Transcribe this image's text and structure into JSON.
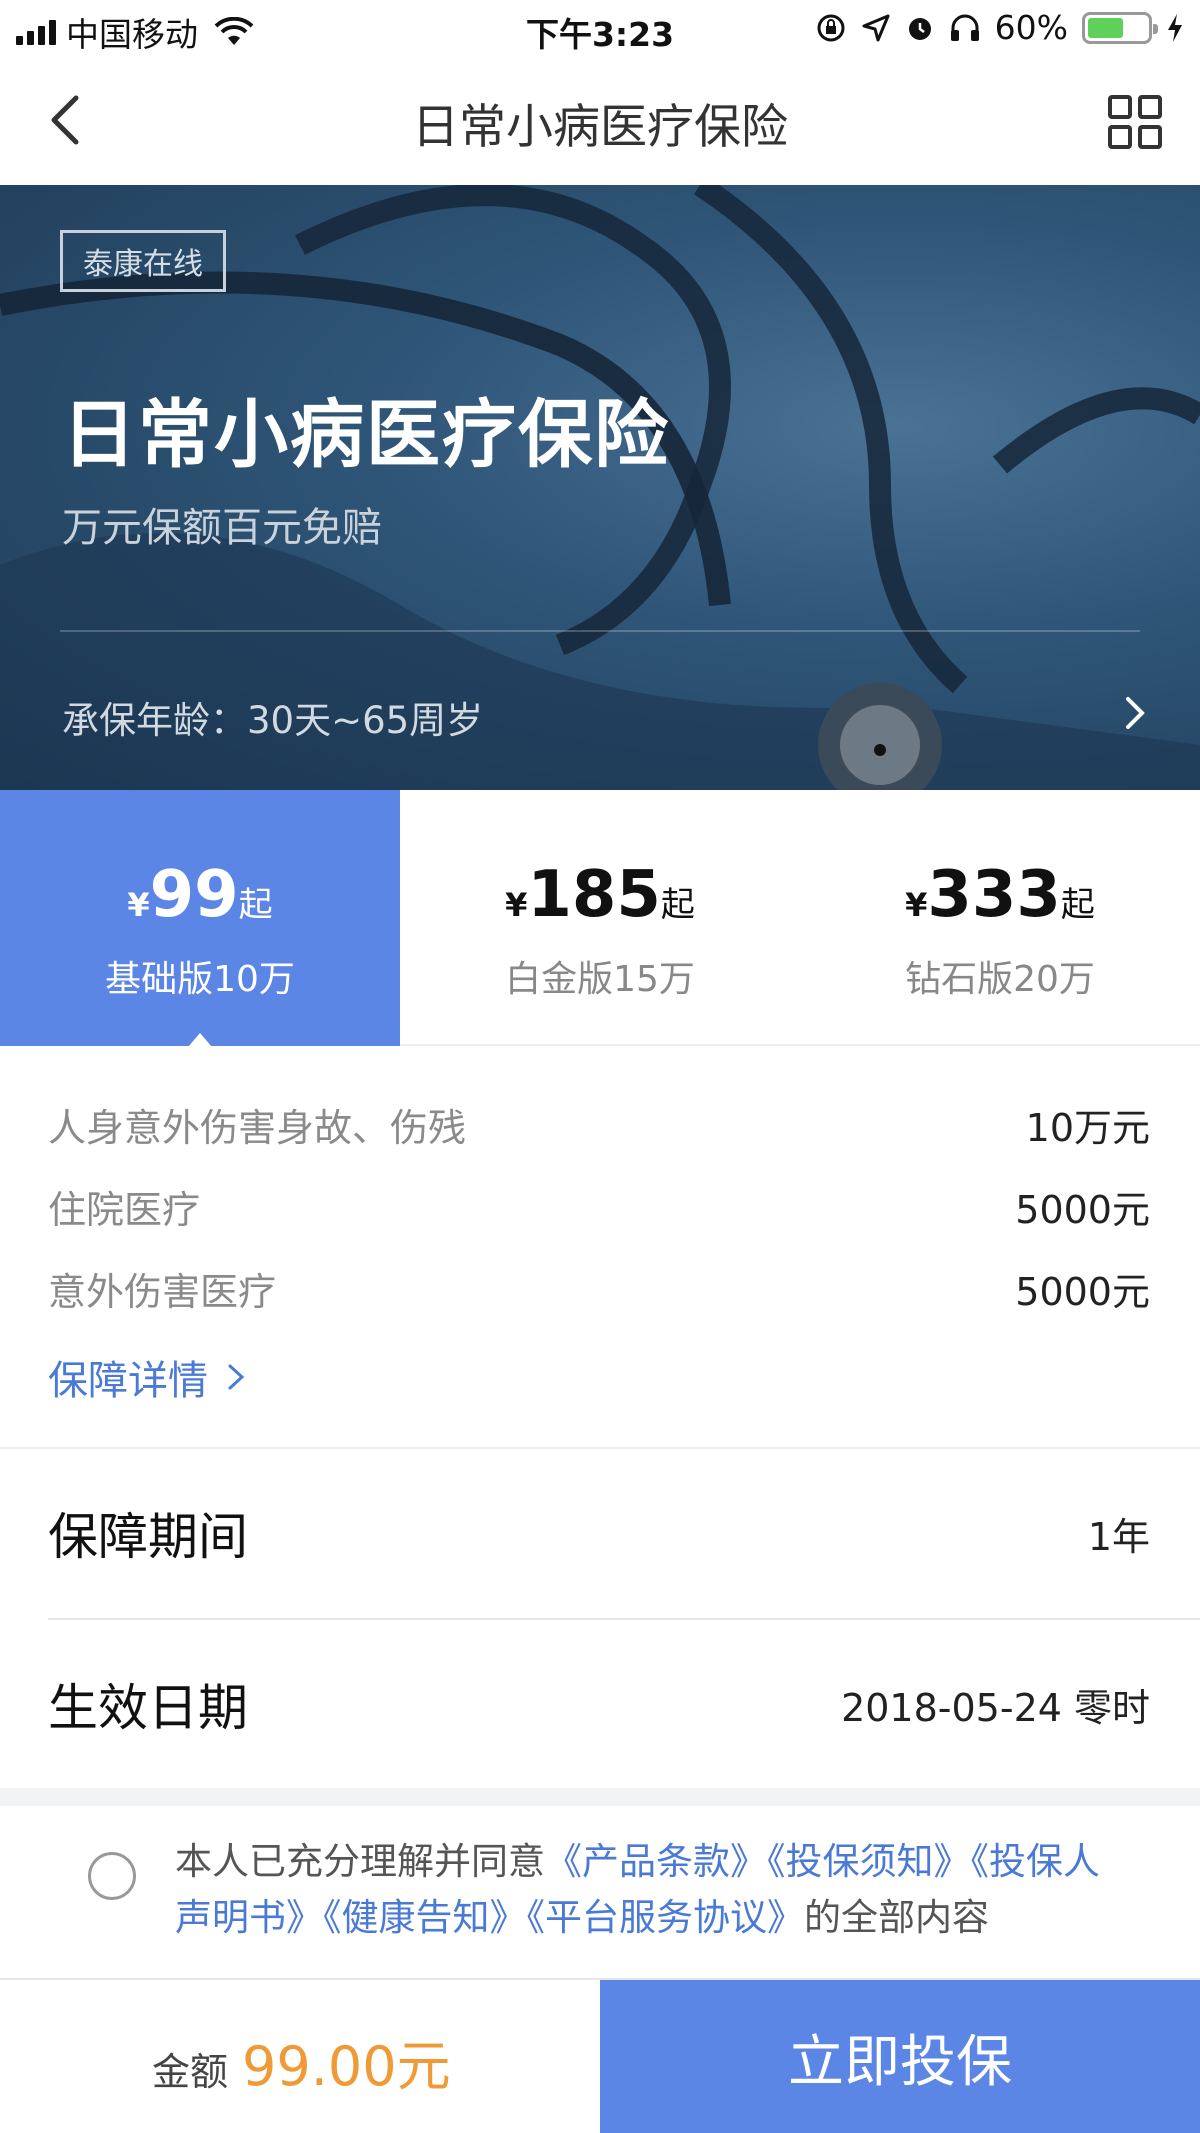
{
  "status_bar": {
    "carrier": "中国移动",
    "time": "下午3:23",
    "battery": "60%",
    "battery_level": 0.6
  },
  "nav": {
    "title": "日常小病医疗保险",
    "back_icon": "chevron-left-icon",
    "menu_icon": "grid-icon"
  },
  "hero": {
    "badge": "泰康在线",
    "title": "日常小病医疗保险",
    "subtitle": "万元保额百元免赔",
    "age_range": "承保年龄：30天~65周岁"
  },
  "plans": [
    {
      "symbol": "¥",
      "price": "99",
      "suffix": "起",
      "name": "基础版10万",
      "active": true
    },
    {
      "symbol": "¥",
      "price": "185",
      "suffix": "起",
      "name": "白金版15万",
      "active": false
    },
    {
      "symbol": "¥",
      "price": "333",
      "suffix": "起",
      "name": "钻石版20万",
      "active": false
    }
  ],
  "coverage": {
    "items": [
      {
        "label": "人身意外伤害身故、伤残",
        "value": "10万元"
      },
      {
        "label": "住院医疗",
        "value": "5000元"
      },
      {
        "label": "意外伤害医疗",
        "value": "5000元"
      }
    ],
    "detail_link": "保障详情"
  },
  "period": {
    "label": "保障期间",
    "value": "1年"
  },
  "effective": {
    "label": "生效日期",
    "value": "2018-05-24 零时"
  },
  "agreement": {
    "prefix": "本人已充分理解并同意",
    "docs": [
      "《产品条款》",
      "《投保须知》",
      "《投保人声明书》",
      "《健康告知》",
      "《平台服务协议》"
    ],
    "suffix": "的全部内容"
  },
  "bottom": {
    "amount_label": "金额",
    "amount_value": "99.00元",
    "submit_label": "立即投保"
  },
  "colors": {
    "accent": "#5b86e5",
    "link": "#4a7ad6",
    "price": "#f09a37",
    "battery": "#5fd15a"
  }
}
